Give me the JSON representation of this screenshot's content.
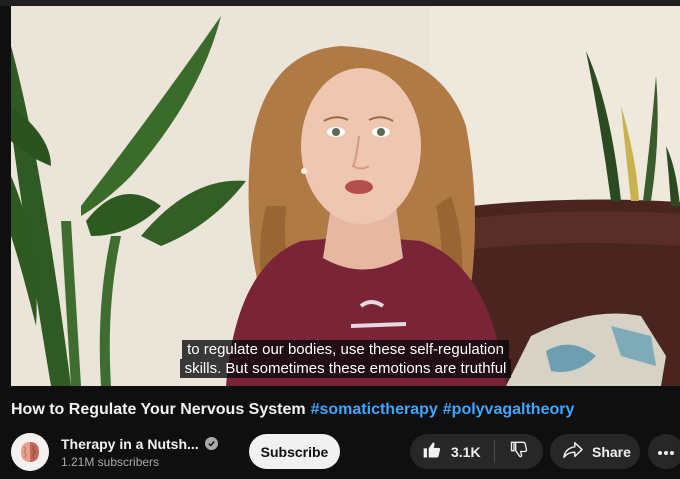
{
  "video": {
    "subtitle_line1": "to regulate our bodies, use these self-regulation",
    "subtitle_line2": "skills. But sometimes these emotions are truthful"
  },
  "title": {
    "text": "How to Regulate Your Nervous System",
    "hashtags": [
      "#somatictherapy",
      "#polyvagaltheory"
    ]
  },
  "channel": {
    "name": "Therapy in a Nutsh...",
    "subscribers": "1.21M subscribers",
    "avatar_icon": "brain-avatar-icon",
    "verified_icon": "verified-check-icon"
  },
  "actions": {
    "subscribe_label": "Subscribe",
    "like_count": "3.1K",
    "share_label": "Share",
    "like_icon": "thumbs-up-icon",
    "dislike_icon": "thumbs-down-icon",
    "share_icon": "share-arrow-icon",
    "more_icon": "more-horizontal-icon"
  },
  "colors": {
    "background": "#0f0f0f",
    "hashtag": "#3ea6ff",
    "pill": "#272727",
    "subscribe_bg": "#f1f1f1"
  }
}
